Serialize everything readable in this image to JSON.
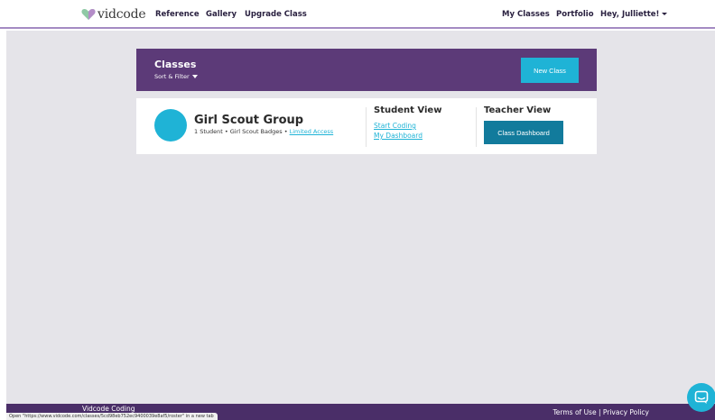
{
  "nav": {
    "logo_text": "vidcode",
    "links": [
      "Reference",
      "Gallery",
      "Upgrade Class"
    ],
    "right_links": [
      "My Classes",
      "Portfolio"
    ],
    "user_menu": "Hey, Julliette!"
  },
  "classes_header": {
    "title": "Classes",
    "sort_filter": "Sort & Filter",
    "new_class_label": "New Class"
  },
  "class_card": {
    "name": "Girl Scout Group",
    "meta": "1 Student • Girl Scout Badges • ",
    "limited_access": "Limited Access",
    "student_view": {
      "title": "Student View",
      "links": [
        "Start Coding",
        "My Dashboard"
      ]
    },
    "teacher_view": {
      "title": "Teacher View",
      "dashboard_label": "Class Dashboard"
    }
  },
  "footer": {
    "left_text": "Vidcode Coding",
    "right_text": "Terms of Use  |  Privacy Policy"
  },
  "status_bar": {
    "text": "Open \"https://www.vidcode.com/classes/5cd98eb752ec9400039e8af5/roster\" in a new tab"
  },
  "colors": {
    "brand_purple": "#5c3a78",
    "accent_cyan": "#1fb3d6",
    "dashboard_teal": "#127b9c",
    "footer_purple": "#4a2e68"
  },
  "icons": {
    "logo": "heart-logo-icon",
    "chat": "chat-bubble-icon"
  }
}
